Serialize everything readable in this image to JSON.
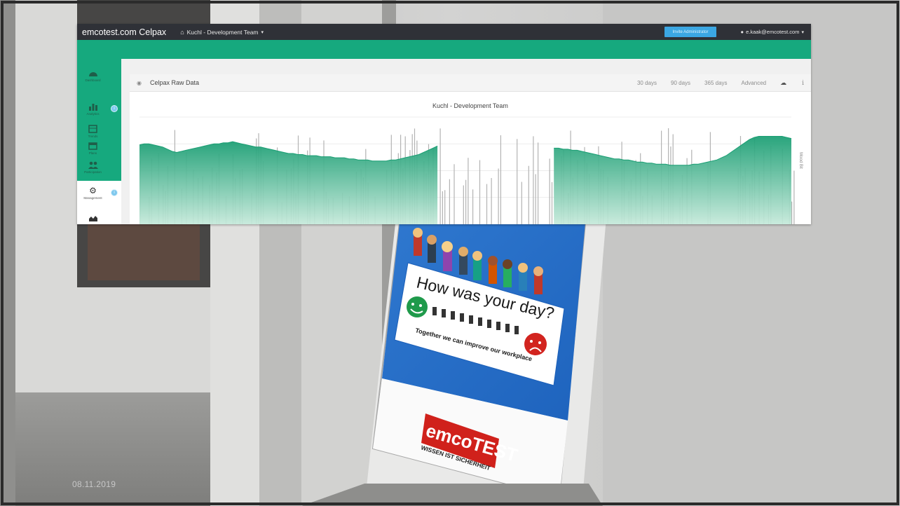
{
  "app": {
    "brand": "emcotest.com Celpax",
    "team_menu": "Kuchl - Development Team",
    "topbar_button": "Invite Administrator",
    "user_menu": "e.kaak@emcotest.com"
  },
  "sidebar": {
    "items": [
      {
        "label": "Dashboard",
        "icon": "dashboard-icon"
      },
      {
        "label": "Analytics",
        "icon": "bar-chart-icon"
      },
      {
        "label": "Trends",
        "icon": "calendar-list-icon"
      },
      {
        "label": "Plans",
        "icon": "calendar-icon"
      },
      {
        "label": "Participation",
        "icon": "people-icon"
      },
      {
        "label": "Management",
        "icon": "gear-icon"
      },
      {
        "label": "",
        "icon": "area-chart-icon"
      }
    ]
  },
  "card": {
    "title": "Celpax Raw Data",
    "ranges": [
      "30 days",
      "90 days",
      "365 days",
      "Advanced"
    ]
  },
  "chart_data": {
    "type": "area",
    "title": "Kuchl - Development Team",
    "ylabel": "Mood Bit",
    "series": [
      {
        "values": [
          0.74,
          0.75,
          0.75,
          0.74,
          0.73,
          0.72,
          0.7,
          0.68,
          0.67,
          0.68,
          0.69,
          0.7,
          0.71,
          0.72,
          0.73,
          0.74,
          0.75,
          0.75,
          0.76,
          0.76,
          0.77,
          0.76,
          0.75,
          0.74,
          0.73,
          0.72,
          0.72,
          0.71,
          0.7,
          0.69,
          0.68,
          0.67,
          0.66,
          0.66,
          0.65,
          0.65,
          0.64,
          0.64,
          0.64,
          0.63,
          0.63,
          0.63,
          0.62,
          0.62,
          0.62,
          0.61,
          0.61,
          0.6,
          0.6,
          0.6,
          0.59,
          0.59,
          0.59,
          0.59,
          0.6,
          0.6,
          0.61,
          0.62,
          0.63,
          0.64,
          0.65,
          0.67,
          0.69,
          0.71,
          0.73,
          null,
          null,
          null,
          null,
          null,
          null,
          null,
          null,
          null,
          null,
          null,
          null,
          null,
          null,
          null,
          null,
          null,
          null,
          null,
          null,
          null,
          null,
          null,
          null,
          0.71,
          0.71,
          0.7,
          0.7,
          0.69,
          0.69,
          0.68,
          0.67,
          0.66,
          0.65,
          0.64,
          0.63,
          0.62,
          0.61,
          0.61,
          0.6,
          0.6,
          0.59,
          0.58,
          0.58,
          0.57,
          0.57,
          0.56,
          0.56,
          0.56,
          0.55,
          0.55,
          0.55,
          0.55,
          0.55,
          0.56,
          0.56,
          0.57,
          0.58,
          0.59,
          0.6,
          0.62,
          0.64,
          0.67,
          0.7,
          0.73,
          0.76,
          0.79,
          0.81,
          0.82,
          0.82,
          0.82,
          0.82,
          0.82,
          0.82,
          0.81,
          0.8
        ]
      }
    ],
    "grid": true,
    "colors": {
      "area_top": "#1a9e73",
      "area_bottom": "#c5e9da",
      "bars": "#b3b3b3"
    }
  },
  "slide": {
    "date": "08.11.2019",
    "device_heading": "How was your day?",
    "device_subtext": "Together we can improve our workplace",
    "device_logo": "emcoTEST",
    "device_slogan": "WISSEN IST SICHERHEIT"
  }
}
